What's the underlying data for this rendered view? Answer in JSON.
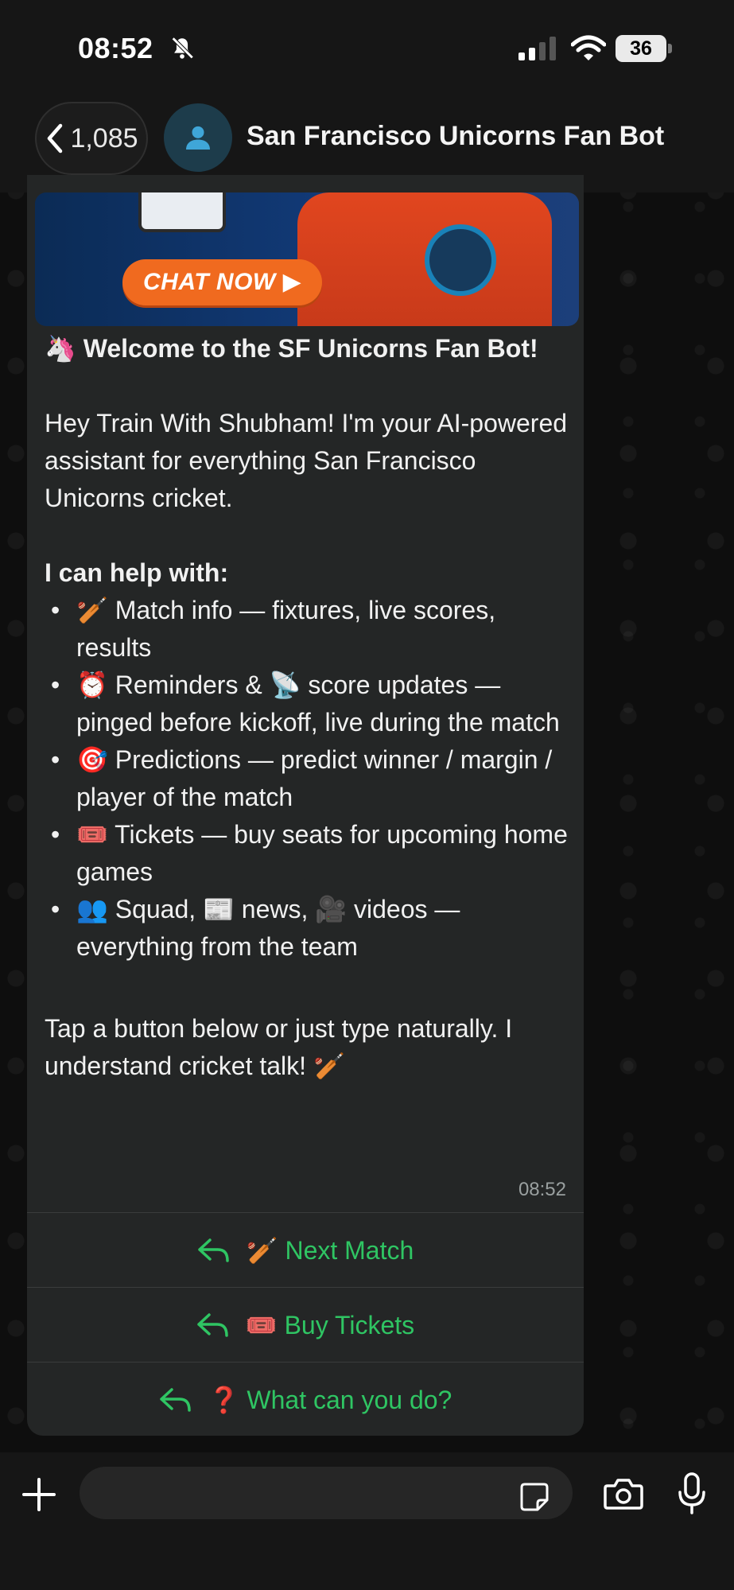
{
  "status_bar": {
    "time": "08:52",
    "battery": "36"
  },
  "header": {
    "back_count": "1,085",
    "title": "San Francisco Unicorns Fan Bot"
  },
  "banner": {
    "cta": "CHAT NOW ▶"
  },
  "message": {
    "welcome": "🦄 Welcome to the SF Unicorns Fan Bot!",
    "intro": "Hey Train With Shubham! I'm your AI-powered assistant for everything San Francisco Unicorns cricket.",
    "help_heading": "I can help with:",
    "items": [
      "🏏 Match info — fixtures, live scores, results",
      "⏰ Reminders & 📡 score updates — pinged before kickoff, live during the match",
      "🎯 Predictions — predict winner / margin / player of the match",
      "🎟️ Tickets — buy seats for upcoming home games",
      "👥 Squad, 📰 news, 🎥 videos — everything from the team"
    ],
    "outro": "Tap a button below or just type naturally. I understand cricket talk! 🏏",
    "time": "08:52"
  },
  "quick_replies": [
    "🏏 Next Match",
    "🎟️ Buy Tickets",
    "❓ What can you do?"
  ],
  "colors": {
    "accent_green": "#2fc563",
    "bubble": "#242626",
    "bar": "#161616"
  }
}
